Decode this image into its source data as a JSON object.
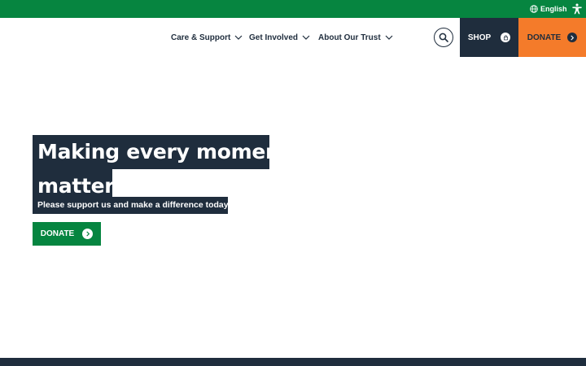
{
  "colors": {
    "brand_green": "#068540",
    "navy": "#1f2d3d",
    "orange": "#f47b2a",
    "white": "#ffffff"
  },
  "topbar": {
    "language_label": "English",
    "language_icon": "globe-icon",
    "accessibility_icon": "accessibility-icon"
  },
  "nav": {
    "items": [
      {
        "label": "Care & Support",
        "icon": "chevron-down-icon"
      },
      {
        "label": "Get Involved",
        "icon": "chevron-down-icon"
      },
      {
        "label": "About Our Trust",
        "icon": "chevron-down-icon"
      }
    ],
    "search_icon": "search-icon",
    "shop_label": "SHOP",
    "shop_icon": "shopping-bag-icon",
    "donate_label": "DONATE",
    "donate_icon": "chevron-right-icon"
  },
  "hero": {
    "headline_line1": "Making every moment",
    "headline_line2": "matter",
    "subheading": "Please support us and make a difference today",
    "donate_label": "DONATE",
    "donate_icon": "chevron-right-icon"
  }
}
